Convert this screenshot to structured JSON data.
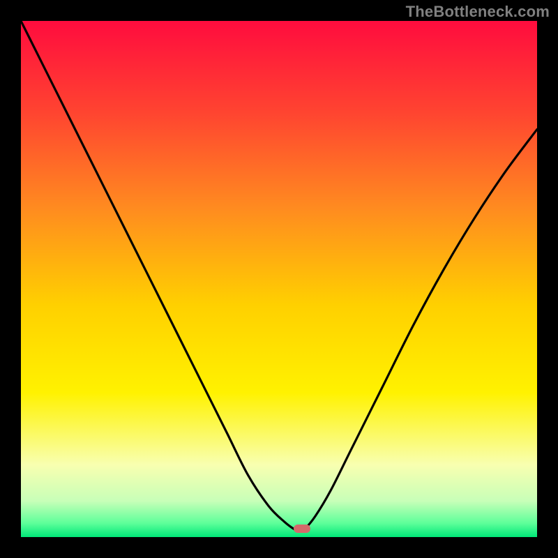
{
  "watermark": "TheBottleneck.com",
  "colors": {
    "background": "#000000",
    "marker": "#d46a6a",
    "curve": "#000000",
    "gradient_stops": [
      {
        "offset": 0.0,
        "color": "#ff0c3e"
      },
      {
        "offset": 0.18,
        "color": "#ff4530"
      },
      {
        "offset": 0.36,
        "color": "#ff8a20"
      },
      {
        "offset": 0.55,
        "color": "#ffd000"
      },
      {
        "offset": 0.72,
        "color": "#fff200"
      },
      {
        "offset": 0.86,
        "color": "#f8ffb0"
      },
      {
        "offset": 0.93,
        "color": "#c8ffb8"
      },
      {
        "offset": 0.973,
        "color": "#5eff9a"
      },
      {
        "offset": 1.0,
        "color": "#00e878"
      }
    ]
  },
  "chart_data": {
    "type": "line",
    "title": "",
    "xlabel": "",
    "ylabel": "",
    "xlim": [
      0,
      100
    ],
    "ylim": [
      0,
      100
    ],
    "grid": false,
    "minimum_x": 54,
    "marker": {
      "x": 54.5,
      "y": 1.6
    },
    "series": [
      {
        "name": "bottleneck-curve",
        "x": [
          0,
          4,
          8,
          12,
          16,
          20,
          24,
          28,
          32,
          36,
          40,
          44,
          48,
          51,
          53,
          54,
          55,
          57,
          60,
          64,
          70,
          76,
          82,
          88,
          94,
          100
        ],
        "values": [
          100,
          92,
          84,
          76,
          68,
          60,
          52,
          44,
          36,
          28,
          20,
          12,
          6,
          3,
          1.5,
          1.2,
          1.6,
          4,
          9,
          17,
          29,
          41,
          52,
          62,
          71,
          79
        ]
      }
    ]
  }
}
